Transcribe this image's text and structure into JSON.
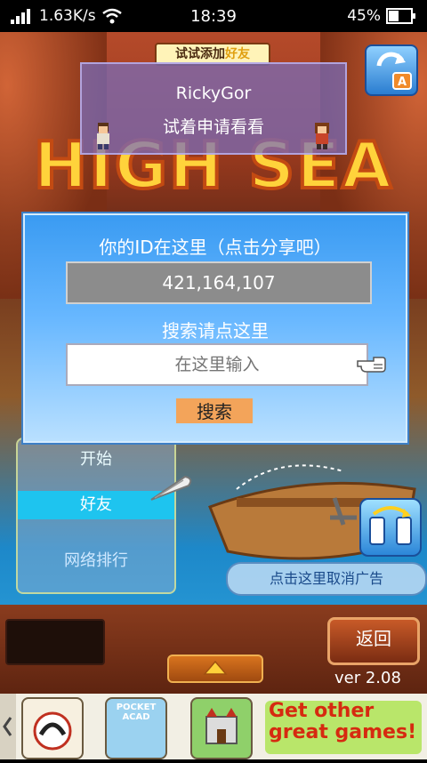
{
  "status": {
    "speed": "1.63K/s",
    "time": "18:39",
    "battery": "45%"
  },
  "top_banner": {
    "prefix": "试试添加",
    "highlight": "好友"
  },
  "friend_card": {
    "name": "RickyGor",
    "hint": "试着申请看看"
  },
  "logo": {
    "text": "HIGH SEA"
  },
  "dialog": {
    "title": "你的ID在这里（点击分享吧）",
    "id_value": "421,164,107",
    "search_title": "搜索请点这里",
    "search_placeholder": "在这里输入",
    "search_button": "搜索"
  },
  "menu": {
    "start": "开始",
    "friends": "好友",
    "ranking": "网络排行"
  },
  "remove_ads": "点击这里取消广告",
  "back_button": "返回",
  "version": "ver 2.08",
  "ad": {
    "cta_line1": "Get other",
    "cta_line2": "great games!",
    "tile2_label": "POCKET ACAD"
  },
  "colors": {
    "dialog_blue": "#3a9bf2",
    "search_btn": "#f3a45a",
    "menu_highlight": "#1ec4ef"
  }
}
